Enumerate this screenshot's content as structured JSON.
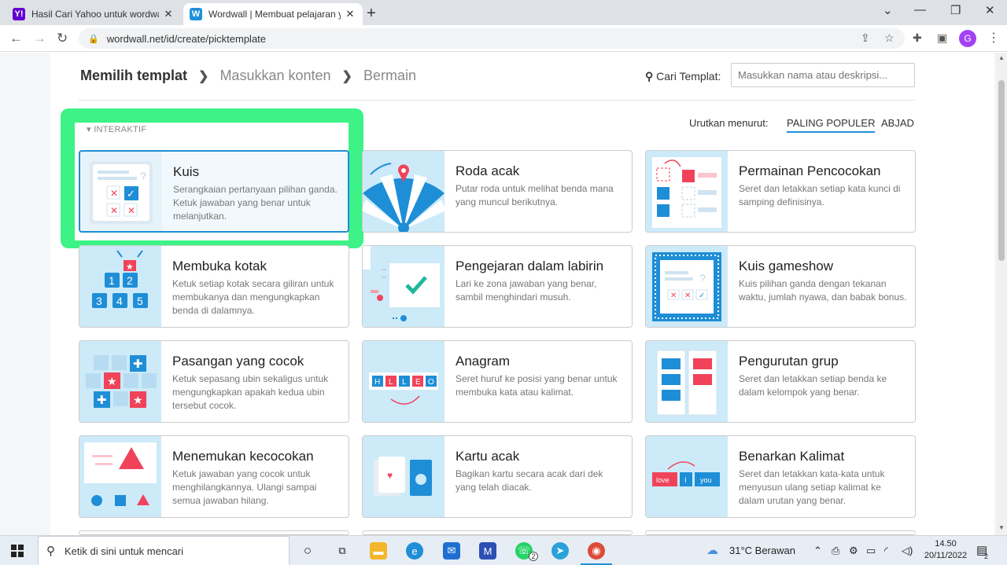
{
  "browser": {
    "tabs": [
      {
        "title": "Hasil Cari Yahoo untuk wordwall",
        "favicon": "Y!",
        "active": false
      },
      {
        "title": "Wordwall | Membuat pelajaran yang",
        "favicon": "W",
        "active": true
      }
    ],
    "new_tab": "+",
    "window_controls": {
      "minimize": "—",
      "maximize": "❐",
      "close": "✕",
      "tabsearch": "⌄"
    },
    "url": "wordwall.net/id/create/picktemplate",
    "avatar": "G"
  },
  "header": {
    "breadcrumb": [
      "Memilih templat",
      "Masukkan konten",
      "Bermain"
    ],
    "search_label": "Cari Templat:",
    "search_placeholder": "Masukkan nama atau deskripsi..."
  },
  "sort": {
    "label": "Urutkan menurut:",
    "options": [
      "PALING POPULER",
      "ABJAD"
    ],
    "active": "PALING POPULER"
  },
  "section_label": "INTERAKTIF",
  "templates": [
    {
      "name": "Kuis",
      "desc": "Serangkaian pertanyaan pilihan ganda. Ketuk jawaban yang benar untuk melanjutkan.",
      "selected": true
    },
    {
      "name": "Roda acak",
      "desc": "Putar roda untuk melihat benda mana yang muncul berikutnya."
    },
    {
      "name": "Permainan Pencocokan",
      "desc": "Seret dan letakkan setiap kata kunci di samping definisinya."
    },
    {
      "name": "Membuka kotak",
      "desc": "Ketuk setiap kotak secara giliran untuk membukanya dan mengungkapkan benda di dalamnya."
    },
    {
      "name": "Pengejaran dalam labirin",
      "desc": "Lari ke zona jawaban yang benar, sambil menghindari musuh."
    },
    {
      "name": "Kuis gameshow",
      "desc": "Kuis pilihan ganda dengan tekanan waktu, jumlah nyawa, dan babak bonus."
    },
    {
      "name": "Pasangan yang cocok",
      "desc": "Ketuk sepasang ubin sekaligus untuk mengungkapkan apakah kedua ubin tersebut cocok."
    },
    {
      "name": "Anagram",
      "desc": "Seret huruf ke posisi yang benar untuk membuka kata atau kalimat."
    },
    {
      "name": "Pengurutan grup",
      "desc": "Seret dan letakkan setiap benda ke dalam kelompok yang benar."
    },
    {
      "name": "Menemukan kecocokan",
      "desc": "Ketuk jawaban yang cocok untuk menghilangkannya. Ulangi sampai semua jawaban hilang."
    },
    {
      "name": "Kartu acak",
      "desc": "Bagikan kartu secara acak dari dek yang telah diacak."
    },
    {
      "name": "Benarkan Kalimat",
      "desc": "Seret dan letakkan kata-kata untuk menyusun ulang setiap kalimat ke dalam urutan yang benar."
    }
  ],
  "thumb_text": {
    "box_numbers": [
      "1",
      "2",
      "3",
      "4",
      "5"
    ],
    "anagram_letters": [
      "H",
      "L",
      "L",
      "E",
      "O"
    ],
    "sentence_words": [
      "love",
      "I",
      "you"
    ]
  },
  "taskbar": {
    "search_placeholder": "Ketik di sini untuk mencari",
    "weather": "31°C  Berawan",
    "time": "14.50",
    "date": "20/11/2022",
    "whatsapp_badge": "2",
    "notification_badge": "2"
  },
  "colors": {
    "accent": "#1e8ed6",
    "highlight": "#3df286",
    "red": "#f0435a",
    "thumb_bg": "#cdeaf8"
  }
}
